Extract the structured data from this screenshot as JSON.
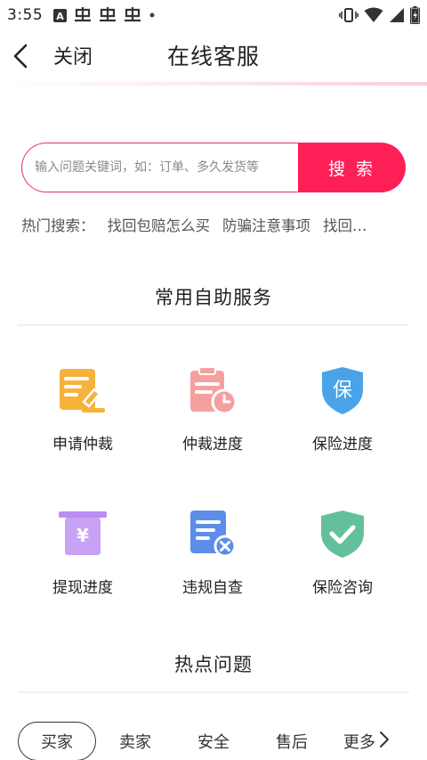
{
  "status_bar": {
    "time": "3:55",
    "notification_icons": [
      "a-badge-icon",
      "chinese-glyph-icon",
      "chinese-glyph-icon",
      "chinese-glyph-icon",
      "dot-icon"
    ],
    "right_icons": [
      "vibrate-icon",
      "wifi-icon",
      "signal-icon",
      "battery-icon"
    ]
  },
  "header": {
    "back_icon": "chevron-left-icon",
    "close_label": "关闭",
    "title": "在线客服"
  },
  "search": {
    "placeholder": "输入问题关键词，如：订单、多久发货等",
    "button_label": "搜 索"
  },
  "hot_search": {
    "label": "热门搜索：",
    "keywords": [
      "找回包赔怎么买",
      "防骗注意事项",
      "找回…"
    ]
  },
  "self_service": {
    "title": "常用自助服务",
    "items": [
      {
        "label": "申请仲裁",
        "icon": "arbitration-icon",
        "color": "#f6b63f"
      },
      {
        "label": "仲裁进度",
        "icon": "clipboard-clock-icon",
        "color": "#f59d9d"
      },
      {
        "label": "保险进度",
        "icon": "insurance-shield-icon",
        "color": "#4aa2e6"
      },
      {
        "label": "提现进度",
        "icon": "withdraw-icon",
        "color": "#b88df0"
      },
      {
        "label": "违规自查",
        "icon": "document-x-icon",
        "color": "#5b8ae8"
      },
      {
        "label": "保险咨询",
        "icon": "check-shield-icon",
        "color": "#5fbf98"
      }
    ]
  },
  "hot_topics": {
    "title": "热点问题",
    "tabs": [
      "买家",
      "卖家",
      "安全",
      "售后"
    ],
    "more_label": "更多"
  },
  "colors": {
    "accent": "#ff1f57",
    "border_accent": "#e7305a"
  }
}
